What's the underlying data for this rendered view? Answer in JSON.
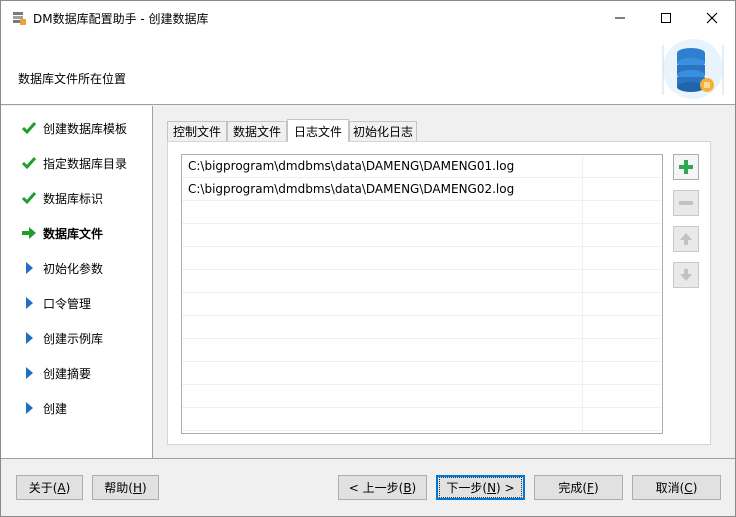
{
  "window": {
    "title": "DM数据库配置助手 - 创建数据库"
  },
  "header": {
    "subtitle": "数据库文件所在位置"
  },
  "nav": {
    "items": [
      {
        "label": "创建数据库模板",
        "state": "done",
        "icon": "check-icon"
      },
      {
        "label": "指定数据库目录",
        "state": "done",
        "icon": "check-icon"
      },
      {
        "label": "数据库标识",
        "state": "done",
        "icon": "check-icon"
      },
      {
        "label": "数据库文件",
        "state": "current",
        "icon": "arrow-right-icon"
      },
      {
        "label": "初始化参数",
        "state": "pending",
        "icon": "triangle-right-icon"
      },
      {
        "label": "口令管理",
        "state": "pending",
        "icon": "triangle-right-icon"
      },
      {
        "label": "创建示例库",
        "state": "pending",
        "icon": "triangle-right-icon"
      },
      {
        "label": "创建摘要",
        "state": "pending",
        "icon": "triangle-right-icon"
      },
      {
        "label": "创建",
        "state": "pending",
        "icon": "triangle-right-icon"
      }
    ]
  },
  "tabs": [
    {
      "label": "控制文件",
      "active": false
    },
    {
      "label": "数据文件",
      "active": false
    },
    {
      "label": "日志文件",
      "active": true
    },
    {
      "label": "初始化日志",
      "active": false
    }
  ],
  "log_files": [
    "C:\\bigprogram\\dmdbms\\data\\DAMENG\\DAMENG01.log",
    "C:\\bigprogram\\dmdbms\\data\\DAMENG\\DAMENG02.log"
  ],
  "buttons": {
    "about": {
      "label": "关于(",
      "key": "A",
      "suffix": ")"
    },
    "help": {
      "label": "帮助(",
      "key": "H",
      "suffix": ")"
    },
    "prev": {
      "label": "< 上一步(",
      "key": "B",
      "suffix": ")"
    },
    "next": {
      "label": "下一步(",
      "key": "N",
      "suffix": ") >"
    },
    "finish": {
      "label": "完成(",
      "key": "F",
      "suffix": ")"
    },
    "cancel": {
      "label": "取消(",
      "key": "C",
      "suffix": ")"
    }
  },
  "colors": {
    "check_green": "#1e9e2a",
    "triangle_blue": "#1f6fc5",
    "add_green": "#2fa84f",
    "default_border": "#0078d7"
  }
}
